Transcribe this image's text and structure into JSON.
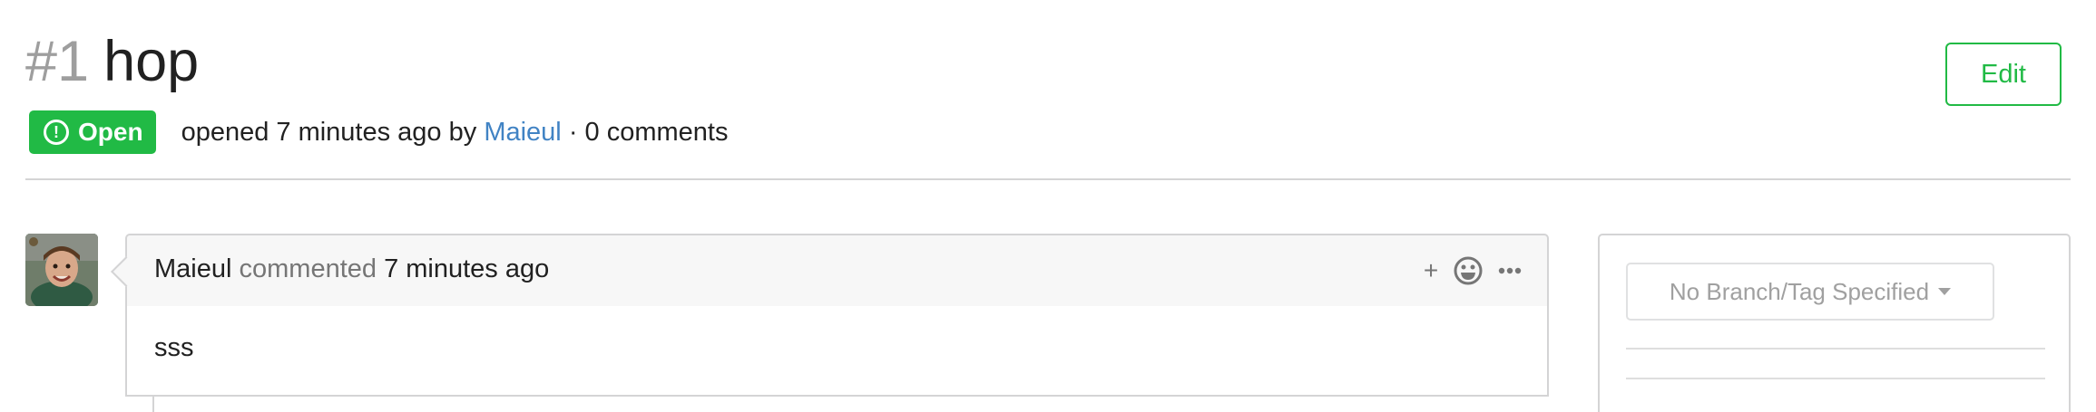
{
  "issue": {
    "index": "#1",
    "title": "hop",
    "edit_label": "Edit",
    "status": "Open",
    "meta_prefix": "opened 7 minutes ago by",
    "author": "Maieul",
    "meta_suffix": "· 0 comments"
  },
  "comment": {
    "author": "Maieul",
    "verb": "commented",
    "time": "7 minutes ago",
    "actions": {
      "plus": "+",
      "icons": [
        "plus-icon",
        "smiley-icon",
        "ellipsis-icon"
      ]
    },
    "body": "sss"
  },
  "sidebar": {
    "branch_select": "No Branch/Tag Specified"
  },
  "colors": {
    "accent_green": "#21ba45",
    "link_blue": "#4183c4",
    "muted_gray": "#9e9e9e",
    "border": "#d4d4d5"
  }
}
